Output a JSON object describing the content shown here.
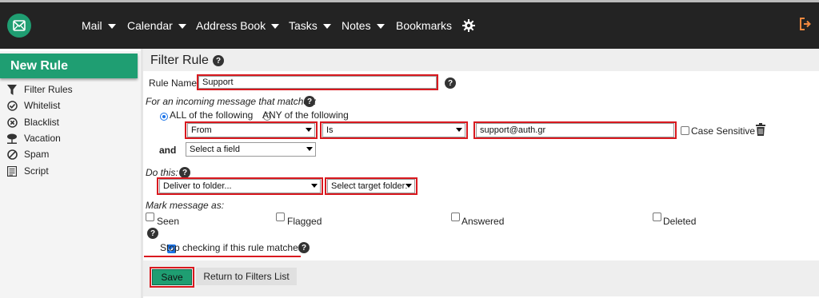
{
  "nav": {
    "items": [
      {
        "label": "Mail",
        "dropdown": true
      },
      {
        "label": "Calendar",
        "dropdown": true
      },
      {
        "label": "Address Book",
        "dropdown": true
      },
      {
        "label": "Tasks",
        "dropdown": true
      },
      {
        "label": "Notes",
        "dropdown": true
      },
      {
        "label": "Bookmarks",
        "dropdown": false
      }
    ],
    "icons": [
      "mail-logo-icon",
      "gear-icon",
      "logout-icon"
    ],
    "accent_color": "#1f9e72",
    "logout_color": "#f0883e"
  },
  "sidebar": {
    "new_rule_label": "New Rule",
    "items": [
      {
        "label": "Filter Rules",
        "icon": "filter-icon"
      },
      {
        "label": "Whitelist",
        "icon": "check-circle-icon"
      },
      {
        "label": "Blacklist",
        "icon": "x-circle-icon"
      },
      {
        "label": "Vacation",
        "icon": "vacation-icon"
      },
      {
        "label": "Spam",
        "icon": "ban-icon"
      },
      {
        "label": "Script",
        "icon": "script-icon"
      }
    ]
  },
  "form": {
    "title": "Filter Rule",
    "rule_name_label": "Rule Name:",
    "rule_name_value": "Support",
    "match_intro": "For an incoming message that matches:",
    "match_all_label": "ALL of the following",
    "match_any_label": "ANY of the following",
    "match_mode": "all",
    "condition": {
      "field": "From",
      "operator": "Is",
      "value": "support@auth.gr",
      "case_sensitive_label": "Case Sensitive",
      "case_sensitive": false
    },
    "and_label": "and",
    "next_field_placeholder": "Select a field",
    "do_this_label": "Do this:",
    "action": "Deliver to folder...",
    "target_folder": "Select target folder:",
    "mark_label": "Mark message as:",
    "marks": [
      {
        "label": "Seen",
        "checked": false
      },
      {
        "label": "Flagged",
        "checked": false
      },
      {
        "label": "Answered",
        "checked": false
      },
      {
        "label": "Deleted",
        "checked": false
      }
    ],
    "stop_label": "Stop checking if this rule matches?",
    "stop_checked": true,
    "save_label": "Save",
    "return_label": "Return to Filters List",
    "highlight_color": "#d9191f"
  }
}
